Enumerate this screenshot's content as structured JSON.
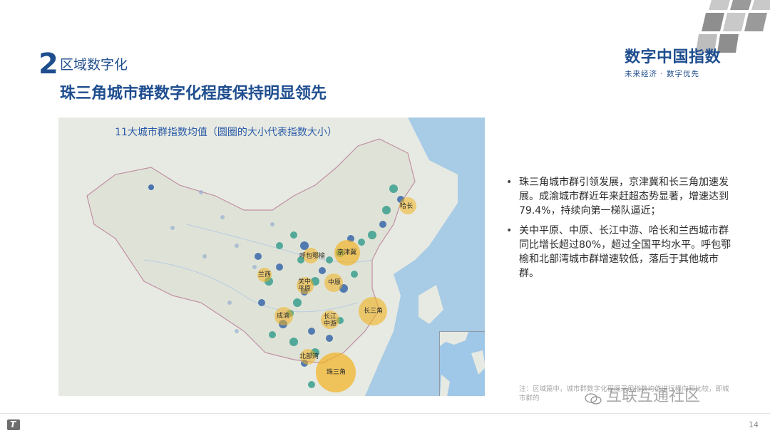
{
  "brand": {
    "title": "数字中国指数",
    "subtitle": "未来经济 · 数字优先"
  },
  "section": {
    "number": "2",
    "label": "区域数字化"
  },
  "headline": "珠三角城市群数字化程度保持明显领先",
  "map": {
    "title": "11大城市群指数均值（圆圈的大小代表指数大小）",
    "city_labels": {
      "harbin": "哈长",
      "jingjinji": "京津冀",
      "hubao": "呼包鄂榆",
      "lanxi": "兰西",
      "guanzhong": "关中平原",
      "zhongyuan": "中原",
      "changjiang": "长三角",
      "chengyu": "成渝",
      "zhongyou": "长江中游",
      "beibuwan": "北部湾",
      "zhusanjiao": "珠三角"
    }
  },
  "bullets": [
    "珠三角城市群引领发展，京津冀和长三角加速发展。成渝城市群近年来赶超态势显著，增速达到79.4%，持续向第一梯队逼近；",
    "关中平原、中原、长江中游、哈长和兰西城市群同比增长超过80%，超过全国平均水平。呼包鄂榆和北部湾城市群增速较低，落后于其他城市群。"
  ],
  "bullet_symbol": "•",
  "note": "注：区域篇中，城市群数字化程度采用指数均值进行横向和比较，即城市群的",
  "watermark": "互联互通社区",
  "footer": {
    "logo_letter": "T",
    "page_number": "14"
  },
  "colors": {
    "primary": "#1f4e8f",
    "bubble_hot": "#f2b21f",
    "bubble_mid": "#2e9a8a",
    "bubble_cool": "#2e5fa8",
    "map_bg": "#e7eae2"
  }
}
